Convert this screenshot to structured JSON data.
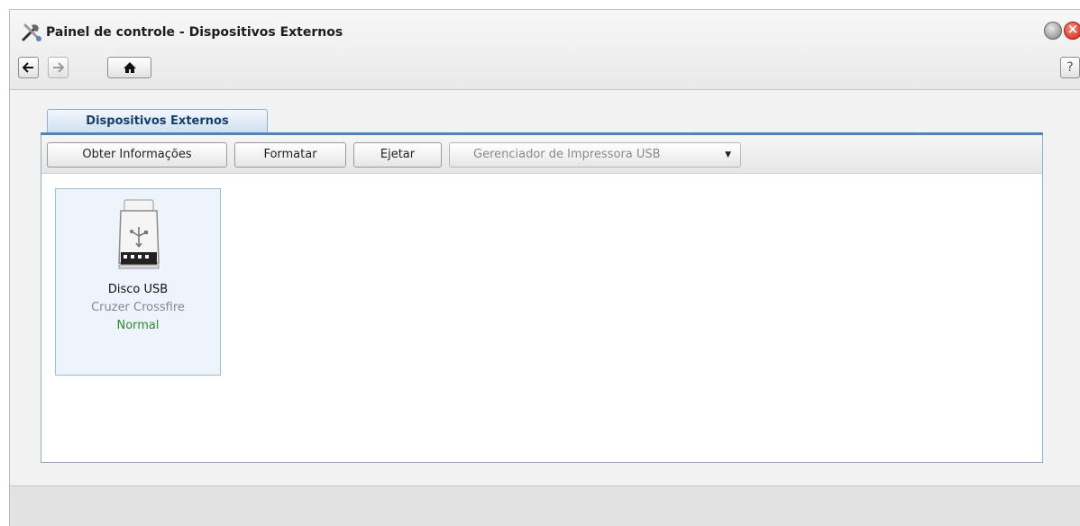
{
  "window": {
    "title": "Painel de controle - Dispositivos Externos"
  },
  "nav": {
    "back_icon": "arrow-left-icon",
    "forward_icon": "arrow-right-icon",
    "home_icon": "home-icon",
    "help_label": "?"
  },
  "tab": {
    "label": "Dispositivos Externos"
  },
  "toolbar": {
    "info_label": "Obter Informações",
    "format_label": "Formatar",
    "eject_label": "Ejetar",
    "print_manager_label": "Gerenciador de Impressora USB"
  },
  "devices": [
    {
      "icon": "usb-drive-icon",
      "name": "Disco USB",
      "model": "Cruzer Crossfire",
      "status": "Normal",
      "status_color": "#2e8b2e"
    }
  ],
  "colors": {
    "accent": "#4b86c4",
    "tab_text": "#16406c"
  }
}
